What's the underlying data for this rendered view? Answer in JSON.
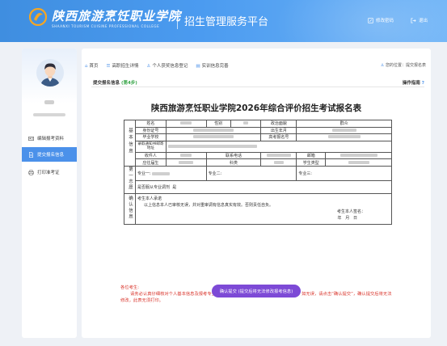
{
  "header": {
    "school_name": "陕西旅游烹饪职业学院",
    "school_name_en": "SHAANXI TOURISM CUISINE PROFESSIONAL COLLEGE",
    "platform": "招生管理服务平台",
    "change_password": "修改密码",
    "logout": "退出"
  },
  "sidebar": {
    "items": [
      {
        "label": "编辑报考资料",
        "icon": "id-card-icon"
      },
      {
        "label": "提交报名信息",
        "icon": "document-icon"
      },
      {
        "label": "打印准考证",
        "icon": "printer-icon"
      }
    ]
  },
  "topnav": {
    "items": [
      "首页",
      "高职招生详情",
      "个人获奖信息登记",
      "实训信息完善"
    ],
    "location": "您的位置：提交报名表"
  },
  "subheader": {
    "title": "提交报名信息",
    "step": "(第4步)",
    "guide": "操作指南",
    "guide_mark": "?"
  },
  "form": {
    "title": "陕西旅游烹饪职业学院2026年综合评价招生考试报名表",
    "section_basic": "基本信息",
    "section_choice": "第一志愿",
    "section_confirm": "确认信息",
    "name_label": "姓名",
    "gender_label": "性别",
    "politics_label": "政治面貌",
    "politics_value": "群众",
    "id_label": "身份证号",
    "birth_label": "出生年月",
    "school_label": "毕业学校",
    "exam_no_label": "高考报名号",
    "mail_addr_label": "录取通知书邮寄地址",
    "receiver_label": "收件人",
    "contact_label": "联系电话",
    "email_label": "邮箱",
    "graduate_label": "应往届生",
    "subject_label": "科类",
    "student_type_label": "学生类型",
    "major1": "专业一:",
    "major2": "专业二:",
    "major3": "专业三:",
    "adjust_label": "是否服从专业调剂",
    "adjust_value": "是",
    "promise_title": "考生本人承诺",
    "promise_text": "以上信息本人已审核无误，并对重审调有信息真实有效。否则责任自负。",
    "sign_label": "考生本人签名：",
    "date_label": "年   月   日"
  },
  "notice": {
    "heading": "各位考生:",
    "text": "请务必认真仔细核对个人基本信息及报考专业，如有误，请点击“编辑报考资料”进行修改；如无误，请点击“确认提交”，确认提交后将无法修改，此表无须打印。"
  },
  "submit_button": "确认提交 (提交后将无法修改报考信息)",
  "colors": {
    "header": "#4b9bf0",
    "active": "#4b91ea",
    "button": "#7d4ad6",
    "notice": "#d9342b"
  }
}
